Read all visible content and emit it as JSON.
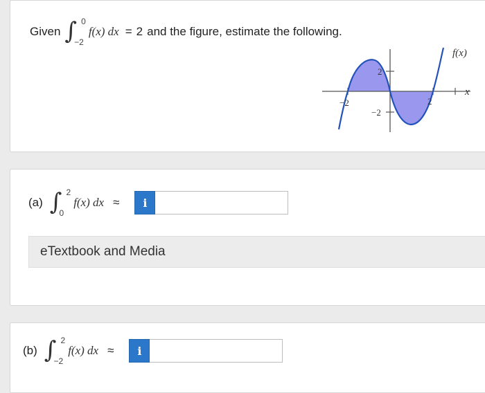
{
  "given": {
    "prefix": "Given",
    "integral": {
      "upper": "0",
      "lower": "−2",
      "integrand": "f(x) dx",
      "equals": "=",
      "value": "2"
    },
    "suffix": "and the figure, estimate the following."
  },
  "graph": {
    "function_label": "f(x)",
    "x_axis_label": "x",
    "tick_labels": {
      "x_neg": "−2",
      "x_pos": "2",
      "y_pos": "2",
      "y_neg": "−2"
    },
    "colors": {
      "fill": "#9a97ef",
      "curve": "#2352b8",
      "axes": "#555555"
    }
  },
  "part_a": {
    "label": "(a)",
    "integral": {
      "upper": "2",
      "lower": "0",
      "integrand": "f(x) dx"
    },
    "approx": "≈",
    "info_icon": "i",
    "input_value": ""
  },
  "etextbook": {
    "label": "eTextbook and Media"
  },
  "part_b": {
    "label": "(b)",
    "integral": {
      "upper": "2",
      "lower": "−2",
      "integrand": "f(x) dx"
    },
    "approx": "≈",
    "info_icon": "i",
    "input_value": ""
  }
}
